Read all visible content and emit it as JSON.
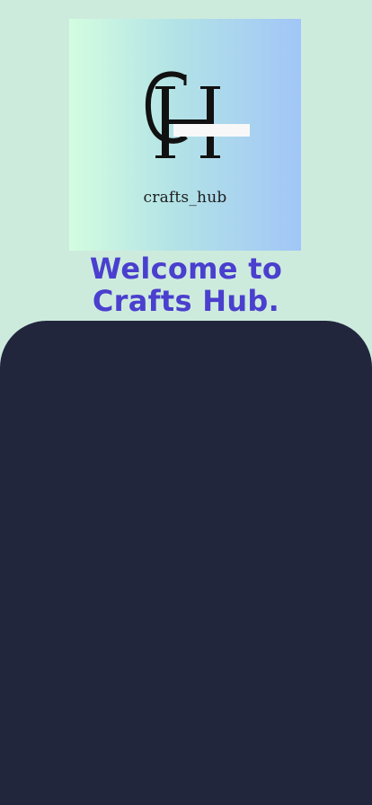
{
  "logo": {
    "monogram": "CH",
    "caption": "crafts_hub"
  },
  "welcome": {
    "line1": "Welcome to",
    "line2": "Crafts Hub."
  },
  "colors": {
    "background": "#cdebdd",
    "heading": "#4a3fce",
    "panel": "#22263d",
    "logo_gradient_start": "#d3fde0",
    "logo_gradient_end": "#a1c6f7"
  }
}
